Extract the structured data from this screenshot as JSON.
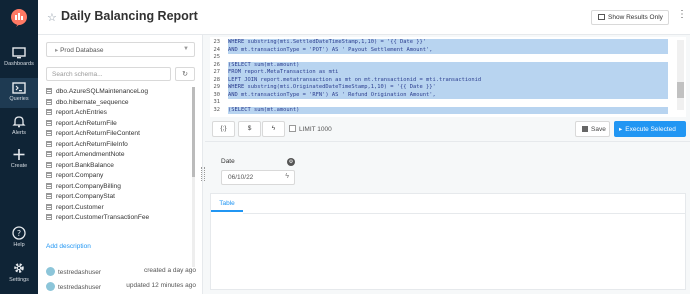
{
  "nav": {
    "items": [
      {
        "label": "Dashboards",
        "icon": "monitor-icon"
      },
      {
        "label": "Queries",
        "icon": "terminal-icon"
      },
      {
        "label": "Alerts",
        "icon": "bell-icon"
      },
      {
        "label": "Create",
        "icon": "plus-icon"
      },
      {
        "label": "Help",
        "icon": "help-icon"
      },
      {
        "label": "Settings",
        "icon": "gear-icon"
      }
    ]
  },
  "header": {
    "title": "Daily Balancing Report",
    "show_results_label": "Show Results Only",
    "more": "⋮"
  },
  "schema": {
    "database": "Prod Database",
    "search_placeholder": "Search schema...",
    "tables": [
      "dbo.AzureSQLMaintenanceLog",
      "dbo.hibernate_sequence",
      "report.AchEntries",
      "report.AchReturnFile",
      "report.AchReturnFileContent",
      "report.AchReturnFileInfo",
      "report.AmendmentNote",
      "report.BankBalance",
      "report.Company",
      "report.CompanyBilling",
      "report.CompanyStat",
      "report.Customer",
      "report.CustomerTransactionFee"
    ],
    "add_description": "Add description",
    "created": {
      "user": "testredashuser",
      "when": "created a day ago"
    },
    "updated": {
      "user": "testredashuser",
      "when": "updated 12 minutes ago"
    }
  },
  "editor": {
    "lines": [
      {
        "n": "23",
        "text": "WHERE substring(mti.SettledDateTimeStamp,1,10) = '{{ Date }}'"
      },
      {
        "n": "24",
        "text": "AND mt.transactionType = 'POT') AS ' Payout Settlement Amount',"
      },
      {
        "n": "25",
        "text": ""
      },
      {
        "n": "26",
        "text": "(SELECT sum(mt.amount)"
      },
      {
        "n": "27",
        "text": "FROM report.MetaTransaction as mti"
      },
      {
        "n": "28",
        "text": "LEFT JOIN report.metatransaction as mt on mt.transactionid = mti.transactionid"
      },
      {
        "n": "29",
        "text": "WHERE substring(mti.OriginatedDateTimeStamp,1,10) = '{{ Date }}'"
      },
      {
        "n": "30",
        "text": "AND mt.transactionType = 'RFN') AS ' Refund Origination Amount',"
      },
      {
        "n": "31",
        "text": ""
      },
      {
        "n": "32",
        "text": "(SELECT sum(mt.amount)"
      }
    ]
  },
  "toolbar": {
    "format_label": "{;}",
    "limit_label": "LIMIT 1000",
    "save_label": "Save",
    "execute_label": "Execute Selected"
  },
  "params": {
    "label": "Date",
    "value": "06/10/22"
  },
  "results": {
    "tab_label": "Table"
  }
}
